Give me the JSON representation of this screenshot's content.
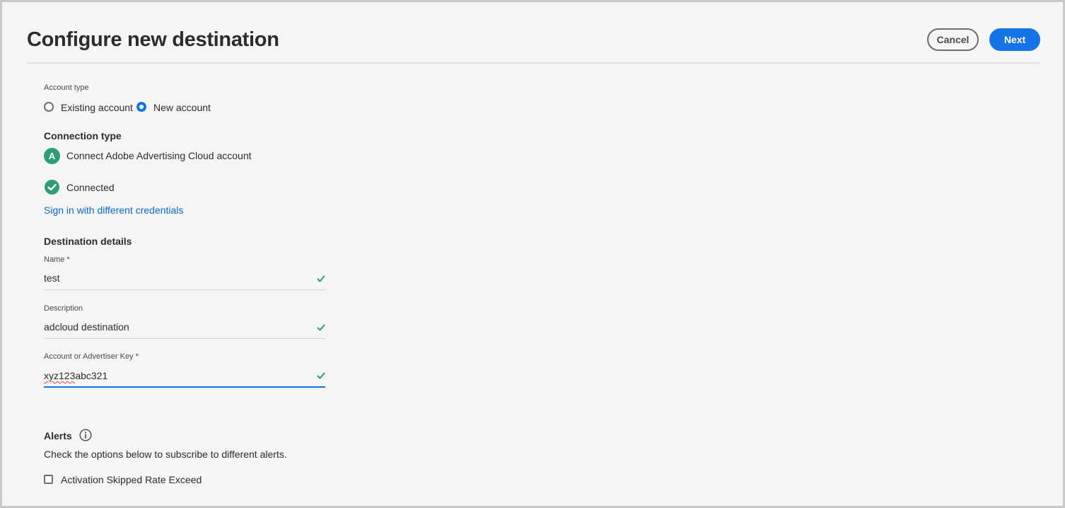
{
  "header": {
    "title": "Configure new destination",
    "cancel_label": "Cancel",
    "next_label": "Next"
  },
  "account_type": {
    "label": "Account type",
    "options": [
      {
        "label": "Existing account",
        "selected": false
      },
      {
        "label": "New account",
        "selected": true
      }
    ]
  },
  "connection": {
    "heading": "Connection type",
    "avatar_letter": "A",
    "account_label": "Connect Adobe Advertising Cloud account",
    "status": "Connected",
    "status_icon": "check-circle-icon",
    "link": "Sign in with different credentials"
  },
  "destination": {
    "heading": "Destination details",
    "fields": [
      {
        "label": "Name",
        "required": "*",
        "value": "test"
      },
      {
        "label": "Description",
        "value": "adcloud destination"
      },
      {
        "label": "Account or Advertiser Key",
        "required": "*",
        "value_prefix": "xyz123",
        "value_suffix": "abc321"
      }
    ]
  },
  "alerts": {
    "heading": "Alerts",
    "description": "Check the options below to subscribe to different alerts.",
    "option": "Activation Skipped Rate Exceed"
  },
  "colors": {
    "accent": "#1473e6",
    "success": "#2d9d78",
    "link": "#0d66d0"
  }
}
